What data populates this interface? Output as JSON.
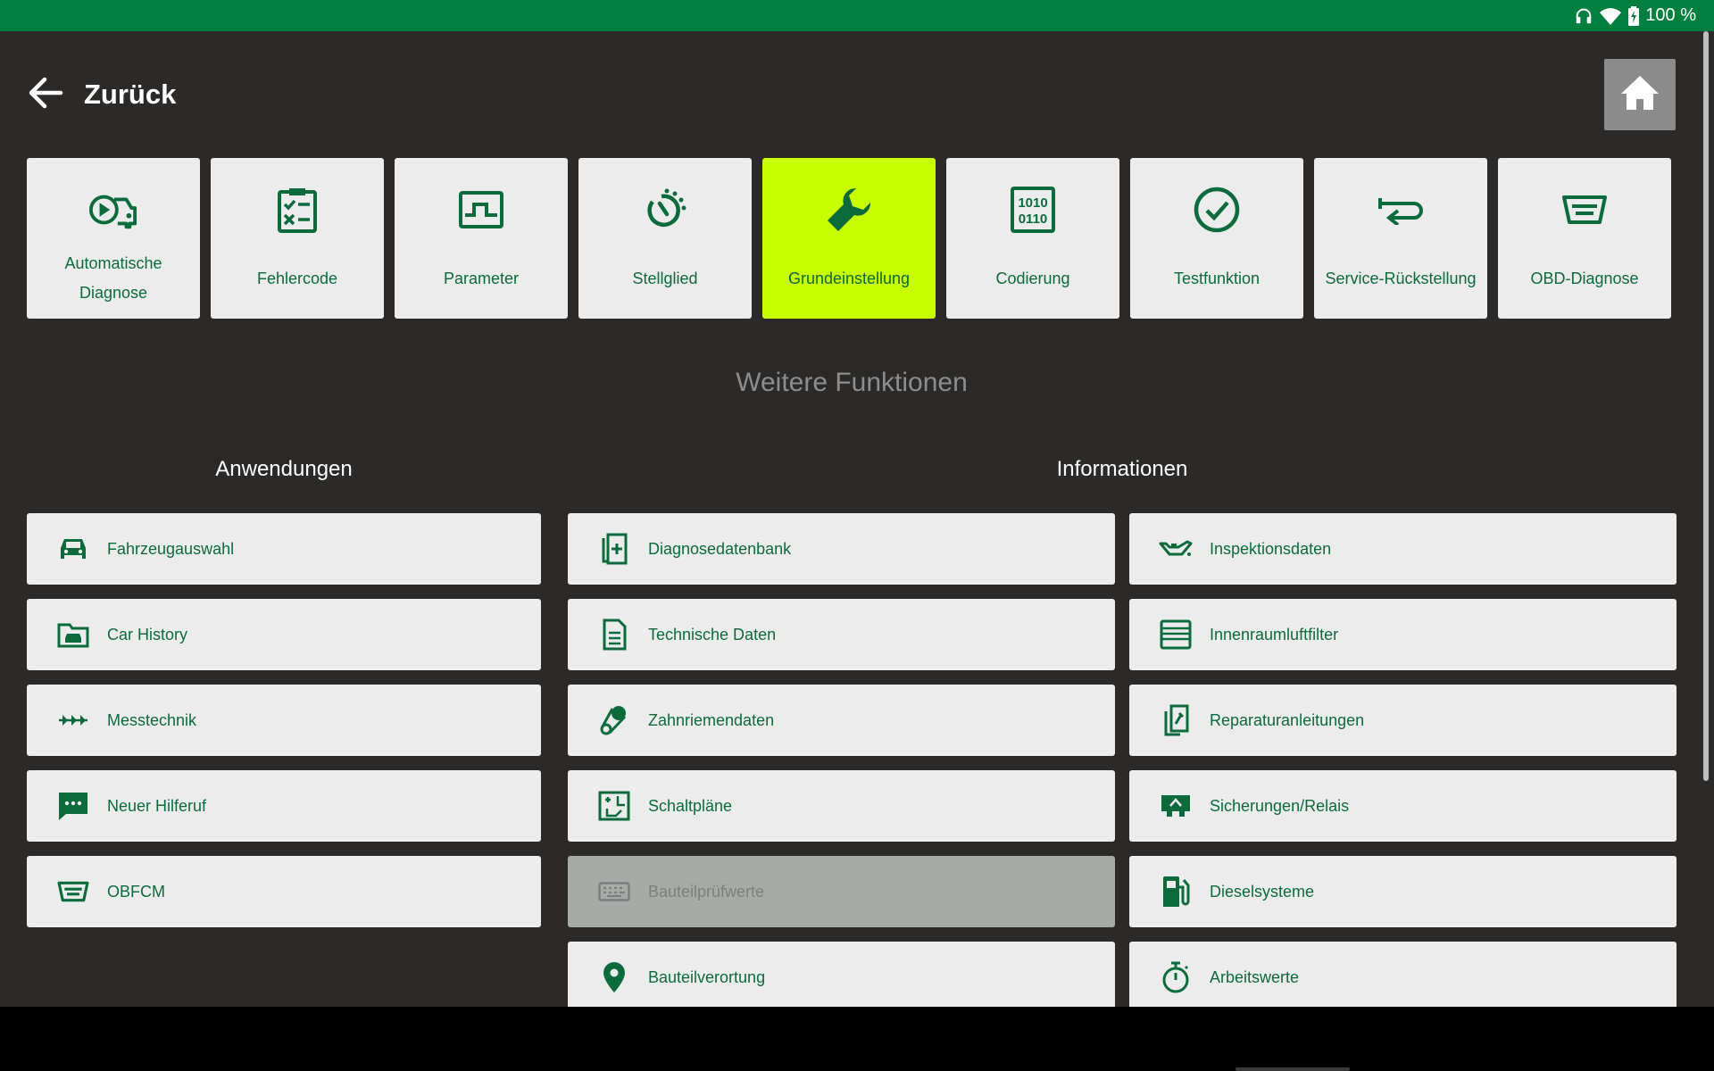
{
  "status": {
    "battery_text": "100 %",
    "icons": [
      "headphones-icon",
      "wifi-icon",
      "battery-charging-icon"
    ]
  },
  "header": {
    "back_label": "Zurück",
    "home_icon": "home-icon"
  },
  "colors": {
    "statusbar": "#007f3f",
    "background": "#2b2a29",
    "accent": "#c8ff00",
    "green": "#0b6b3b",
    "tile": "#ececec"
  },
  "tiles": [
    {
      "label": "Automatische Diagnose",
      "icon": "auto-diagnosis-icon",
      "active": false
    },
    {
      "label": "Fehlercode",
      "icon": "checklist-icon",
      "active": false
    },
    {
      "label": "Parameter",
      "icon": "parameter-icon",
      "active": false
    },
    {
      "label": "Stellglied",
      "icon": "actuator-icon",
      "active": false
    },
    {
      "label": "Grundeinstellung",
      "icon": "wrench-icon",
      "active": true
    },
    {
      "label": "Codierung",
      "icon": "binary-code-icon",
      "active": false
    },
    {
      "label": "Testfunktion",
      "icon": "check-circle-icon",
      "active": false
    },
    {
      "label": "Service-Rückstellung",
      "icon": "return-arrow-icon",
      "active": false
    },
    {
      "label": "OBD-Diagnose",
      "icon": "obd-connector-icon",
      "active": false
    }
  ],
  "section_title": "Weitere Funktionen",
  "applications": {
    "heading": "Anwendungen",
    "items": [
      {
        "label": "Fahrzeugauswahl",
        "icon": "car-icon"
      },
      {
        "label": "Car History",
        "icon": "car-folder-icon"
      },
      {
        "label": "Messtechnik",
        "icon": "signal-arrows-icon"
      },
      {
        "label": "Neuer Hilferuf",
        "icon": "chat-icon"
      },
      {
        "label": "OBFCM",
        "icon": "obd-connector-icon"
      }
    ]
  },
  "information": {
    "heading": "Informationen",
    "left": [
      {
        "label": "Diagnosedatenbank",
        "icon": "database-book-icon",
        "disabled": false
      },
      {
        "label": "Technische Daten",
        "icon": "document-icon",
        "disabled": false
      },
      {
        "label": "Zahnriemendaten",
        "icon": "timing-belt-icon",
        "disabled": false
      },
      {
        "label": "Schaltpläne",
        "icon": "wiring-diagram-icon",
        "disabled": false
      },
      {
        "label": "Bauteilprüfwerte",
        "icon": "keyboard-icon",
        "disabled": true
      },
      {
        "label": "Bauteilverortung",
        "icon": "location-pin-icon",
        "disabled": false
      }
    ],
    "right": [
      {
        "label": "Inspektionsdaten",
        "icon": "oil-can-icon"
      },
      {
        "label": "Innenraumluftfilter",
        "icon": "filter-icon"
      },
      {
        "label": "Reparaturanleitungen",
        "icon": "repair-manual-icon"
      },
      {
        "label": "Sicherungen/Relais",
        "icon": "fuse-relay-icon"
      },
      {
        "label": "Dieselsysteme",
        "icon": "fuel-pump-icon"
      },
      {
        "label": "Arbeitswerte",
        "icon": "stopwatch-icon"
      }
    ]
  }
}
